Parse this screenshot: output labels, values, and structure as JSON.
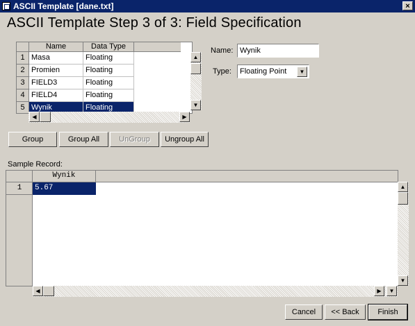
{
  "window": {
    "title": "ASCII Template [dane.txt]",
    "close_glyph": "×"
  },
  "heading": "ASCII Template Step 3 of 3:  Field Specification",
  "field_grid": {
    "columns": [
      "Name",
      "Data Type"
    ],
    "rows": [
      {
        "num": "1",
        "name": "Masa",
        "type": "Floating"
      },
      {
        "num": "2",
        "name": "Promien",
        "type": "Floating"
      },
      {
        "num": "3",
        "name": "FIELD3",
        "type": "Floating"
      },
      {
        "num": "4",
        "name": "FIELD4",
        "type": "Floating"
      },
      {
        "num": "5",
        "name": "Wynik",
        "type": "Floating"
      }
    ],
    "selected_row": 5
  },
  "name_field": {
    "label": "Name:",
    "value": "Wynik"
  },
  "type_field": {
    "label": "Type:",
    "value": "Floating Point"
  },
  "buttons": {
    "group": "Group",
    "group_all": "Group All",
    "ungroup": "UnGroup",
    "ungroup_all": "Ungroup All",
    "cancel": "Cancel",
    "back": "<< Back",
    "finish": "Finish"
  },
  "sample": {
    "label": "Sample Record:",
    "column": "Wynik",
    "row_num": "1",
    "value": "5.67"
  },
  "icons": {
    "up": "▲",
    "down": "▼",
    "left": "◀",
    "right": "▶",
    "select_arrow": "▼"
  },
  "colors": {
    "titlebar": "#0a246a",
    "selection": "#0a246a",
    "face": "#d4d0c8"
  }
}
